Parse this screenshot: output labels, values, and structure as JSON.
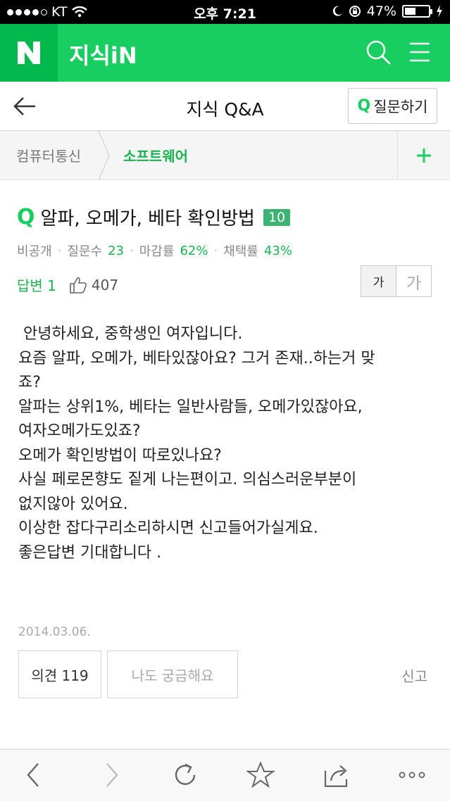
{
  "status_bar": {
    "carrier": "KT",
    "time": "오후 7:21",
    "battery": "47%",
    "battery_level": 0.47
  },
  "header": {
    "logo_letter": "N",
    "app_name": "지식iN",
    "icons": [
      "search-icon",
      "menu-icon"
    ]
  },
  "title_bar": {
    "title": "지식 Q&A",
    "ask_q": "Q",
    "ask_label": "질문하기"
  },
  "breadcrumb": {
    "category": "컴퓨터통신",
    "subcategory": "소프트웨어",
    "add_icon": "plus-icon"
  },
  "question": {
    "q_mark": "Q",
    "title": "알파, 오메가, 베타 확인방법",
    "level": "10",
    "meta": {
      "visibility": "비공개",
      "questions_label": "질문수",
      "questions_value": "23",
      "close_rate_label": "마감률",
      "close_rate_value": "62%",
      "adopt_rate_label": "채택률",
      "adopt_rate_value": "43%"
    },
    "answer_count": "답변 1",
    "likes": "407",
    "font_small": "가",
    "font_large": "가",
    "body_lines": [
      " 안녕하세요, 중학생인 여자입니다.",
      "요즘 알파, 오메가, 베타있잖아요? 그거 존재..하는거 맞",
      "죠?",
      "알파는 상위1%, 베타는 일반사람들, 오메가있잖아요,",
      "여자오메가도있죠?",
      "오메가 확인방법이 따로있나요?",
      "사실 페로몬향도 짙게 나는편이고. 의심스러운부분이",
      "없지않아 있어요.",
      "이상한 잡다구리소리하시면 신고들어가실게요.",
      "좋은답변 기대합니다 ."
    ],
    "date": "2014.03.06."
  },
  "actions": {
    "opinion": "의견 119",
    "curious": "나도 궁금해요",
    "report": "신고"
  },
  "browser_toolbar": {
    "icons": [
      "back-icon",
      "forward-icon",
      "reload-icon",
      "bookmark-icon",
      "share-icon",
      "more-icon"
    ]
  },
  "colors": {
    "naver_green": "#19ce60",
    "logo_green": "#03b84d",
    "accent_text": "#19b34f",
    "level_badge": "#3cb371"
  }
}
